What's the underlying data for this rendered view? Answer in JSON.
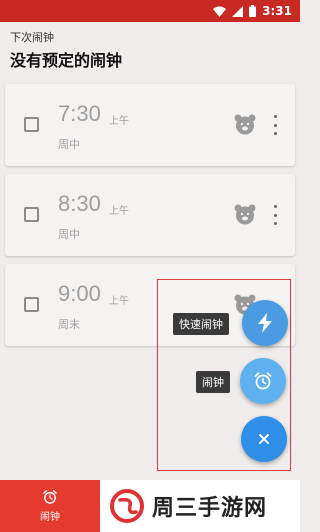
{
  "status_bar": {
    "time": "3:31"
  },
  "header": {
    "subtitle": "下次闹钟",
    "title": "没有预定的闹钟"
  },
  "alarms": [
    {
      "time": "7:30",
      "ampm": "上午",
      "days": "周中"
    },
    {
      "time": "8:30",
      "ampm": "上午",
      "days": "周中"
    },
    {
      "time": "9:00",
      "ampm": "上午",
      "days": "周末"
    }
  ],
  "fab_menu": {
    "quick_alarm_label": "快速闹钟",
    "alarm_label": "闹钟"
  },
  "bottom_nav": {
    "alarm_tab_label": "闹钟"
  },
  "watermark": {
    "text": "周三手游网"
  },
  "colors": {
    "status_bar": "#c82a23",
    "fab_blue": "#4b9be3",
    "tab_active": "#e53a30",
    "highlight_border": "#e53935"
  },
  "icons": {
    "wifi": "wifi-icon",
    "signal": "signal-icon",
    "battery": "battery-icon",
    "bear": "bear-icon",
    "lightning": "lightning-icon",
    "alarm": "alarm-clock-icon",
    "close": "close-icon"
  }
}
